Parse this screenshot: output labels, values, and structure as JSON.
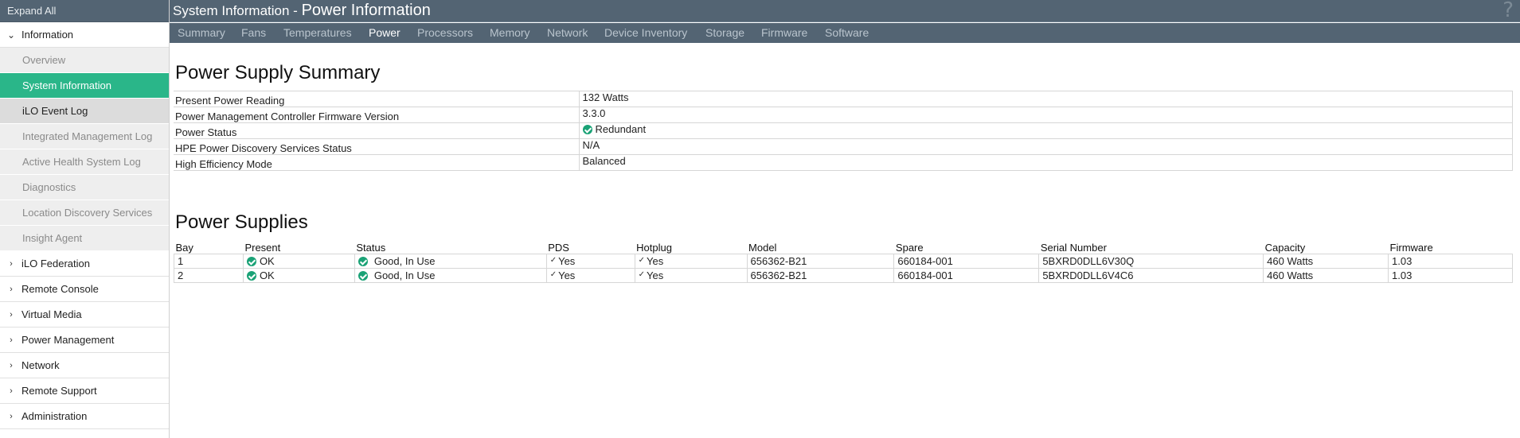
{
  "sidebar": {
    "expand_all": "Expand All",
    "information": "Information",
    "sub_items": [
      {
        "label": "Overview"
      },
      {
        "label": "System Information"
      },
      {
        "label": "iLO Event Log"
      },
      {
        "label": "Integrated Management Log"
      },
      {
        "label": "Active Health System Log"
      },
      {
        "label": "Diagnostics"
      },
      {
        "label": "Location Discovery Services"
      },
      {
        "label": "Insight Agent"
      }
    ],
    "sections": [
      {
        "label": "iLO Federation"
      },
      {
        "label": "Remote Console"
      },
      {
        "label": "Virtual Media"
      },
      {
        "label": "Power Management"
      },
      {
        "label": "Network"
      },
      {
        "label": "Remote Support"
      },
      {
        "label": "Administration"
      }
    ]
  },
  "header": {
    "title_prefix": "System Information - ",
    "title_page": "Power Information",
    "help": "?"
  },
  "tabs": [
    {
      "label": "Summary"
    },
    {
      "label": "Fans"
    },
    {
      "label": "Temperatures"
    },
    {
      "label": "Power"
    },
    {
      "label": "Processors"
    },
    {
      "label": "Memory"
    },
    {
      "label": "Network"
    },
    {
      "label": "Device Inventory"
    },
    {
      "label": "Storage"
    },
    {
      "label": "Firmware"
    },
    {
      "label": "Software"
    }
  ],
  "summary": {
    "title": "Power Supply Summary",
    "rows": [
      {
        "label": "Present Power Reading",
        "value": "132 Watts"
      },
      {
        "label": "Power Management Controller Firmware Version",
        "value": "3.3.0"
      },
      {
        "label": "Power Status",
        "value": "Redundant"
      },
      {
        "label": "HPE Power Discovery Services Status",
        "value": "N/A"
      },
      {
        "label": "High Efficiency Mode",
        "value": "Balanced"
      }
    ]
  },
  "power_supplies": {
    "title": "Power Supplies",
    "columns": [
      "Bay",
      "Present",
      "Status",
      "PDS",
      "Hotplug",
      "Model",
      "Spare",
      "Serial Number",
      "Capacity",
      "Firmware"
    ],
    "rows": [
      {
        "bay": "1",
        "present": "OK",
        "status": "Good, In Use",
        "pds": "Yes",
        "hotplug": "Yes",
        "model": "656362-B21",
        "spare": "660184-001",
        "serial": "5BXRD0DLL6V30Q",
        "capacity": "460 Watts",
        "firmware": "1.03"
      },
      {
        "bay": "2",
        "present": "OK",
        "status": "Good, In Use",
        "pds": "Yes",
        "hotplug": "Yes",
        "model": "656362-B21",
        "spare": "660184-001",
        "serial": "5BXRD0DLL6V4C6",
        "capacity": "460 Watts",
        "firmware": "1.03"
      }
    ]
  },
  "colors": {
    "header": "#536473",
    "active_nav": "#2ab689",
    "ok_icon": "#1aa276"
  }
}
